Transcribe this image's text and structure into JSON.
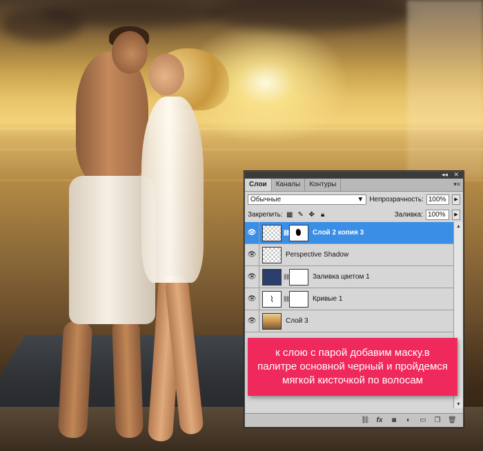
{
  "photo": {
    "description_icon": "beach-couple-photo"
  },
  "panel": {
    "tabs": [
      {
        "label": "Слои",
        "active": true
      },
      {
        "label": "Каналы",
        "active": false
      },
      {
        "label": "Контуры",
        "active": false
      }
    ],
    "blend_mode": "Обычные",
    "opacity_label": "Непрозрачность:",
    "opacity_value": "100%",
    "lock_label": "Закрепить:",
    "fill_label": "Заливка:",
    "fill_value": "100%",
    "layers": [
      {
        "name": "Слой 2 копия 3",
        "selected": true,
        "thumb": "checker",
        "mask": "dark"
      },
      {
        "name": "Perspective Shadow",
        "selected": false,
        "thumb": "checker",
        "mask": null
      },
      {
        "name": "Заливка цветом 1",
        "selected": false,
        "thumb": "navy",
        "mask": "white"
      },
      {
        "name": "Кривые 1",
        "selected": false,
        "thumb": "curves",
        "mask": "white"
      },
      {
        "name": "Слой 3",
        "selected": false,
        "thumb": "photo",
        "mask": null
      }
    ]
  },
  "callout": {
    "text": "к слою с парой добавим маску.в палитре основной черный и пройдемся мягкой кисточкой по волосам",
    "color": "#f0295c"
  },
  "colors": {
    "selection": "#3a8ee6",
    "panel_bg": "#d6d6d6"
  }
}
